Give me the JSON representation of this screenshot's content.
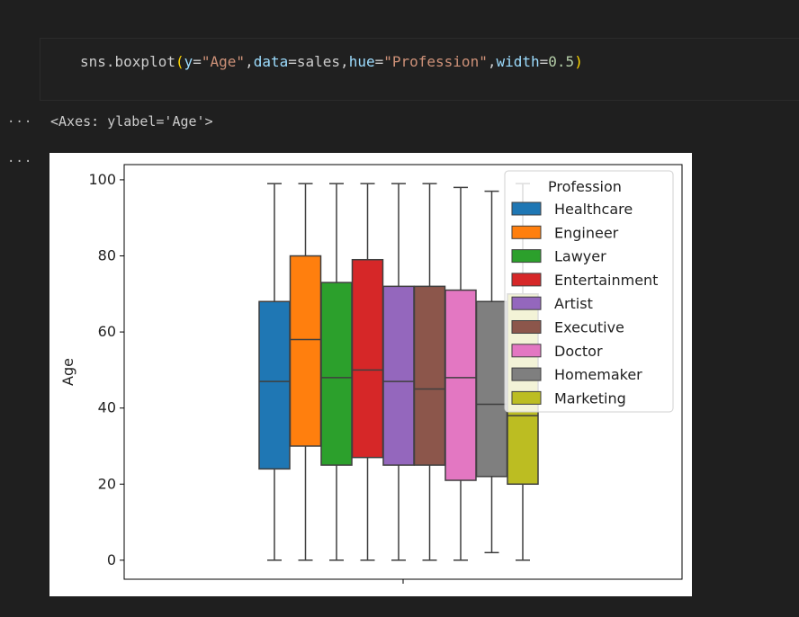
{
  "code_cell": {
    "func": "sns.boxplot",
    "paren_open": "(",
    "paren_close": ")",
    "args": [
      {
        "key": "y",
        "eq": "=",
        "value": "\"Age\"",
        "kind": "str"
      },
      {
        "key": "data",
        "eq": "=",
        "value": "sales",
        "kind": "plain"
      },
      {
        "key": "hue",
        "eq": "=",
        "value": "\"Profession\"",
        "kind": "str"
      },
      {
        "key": "width",
        "eq": "=",
        "value": "0.5",
        "kind": "num"
      }
    ],
    "comma": ","
  },
  "outputs": {
    "ellipsis_1": "···",
    "ellipsis_2": "···",
    "result_text": "<Axes: ylabel='Age'>"
  },
  "chart_data": {
    "type": "boxplot",
    "ylabel": "Age",
    "xlabel": "",
    "ylim": [
      -5,
      104
    ],
    "yticks": [
      0,
      20,
      40,
      60,
      80,
      100
    ],
    "grid": false,
    "legend": {
      "title": "Profession",
      "placement": "upper right"
    },
    "boxes": [
      {
        "name": "Healthcare",
        "color": "#1f77b4",
        "whisker_low": 0,
        "q1": 24,
        "median": 47,
        "q3": 68,
        "whisker_high": 99
      },
      {
        "name": "Engineer",
        "color": "#ff7f0e",
        "whisker_low": 0,
        "q1": 30,
        "median": 58,
        "q3": 80,
        "whisker_high": 99
      },
      {
        "name": "Lawyer",
        "color": "#2ca02c",
        "whisker_low": 0,
        "q1": 25,
        "median": 48,
        "q3": 73,
        "whisker_high": 99
      },
      {
        "name": "Entertainment",
        "color": "#d62728",
        "whisker_low": 0,
        "q1": 27,
        "median": 50,
        "q3": 79,
        "whisker_high": 99
      },
      {
        "name": "Artist",
        "color": "#9467bd",
        "whisker_low": 0,
        "q1": 25,
        "median": 47,
        "q3": 72,
        "whisker_high": 99
      },
      {
        "name": "Executive",
        "color": "#8c564b",
        "whisker_low": 0,
        "q1": 25,
        "median": 45,
        "q3": 72,
        "whisker_high": 99
      },
      {
        "name": "Doctor",
        "color": "#e377c2",
        "whisker_low": 0,
        "q1": 21,
        "median": 48,
        "q3": 71,
        "whisker_high": 98
      },
      {
        "name": "Homemaker",
        "color": "#7f7f7f",
        "whisker_low": 2,
        "q1": 22,
        "median": 41,
        "q3": 68,
        "whisker_high": 97
      },
      {
        "name": "Marketing",
        "color": "#bcbd22",
        "whisker_low": 0,
        "q1": 20,
        "median": 38,
        "q3": 70,
        "whisker_high": 99
      }
    ]
  }
}
